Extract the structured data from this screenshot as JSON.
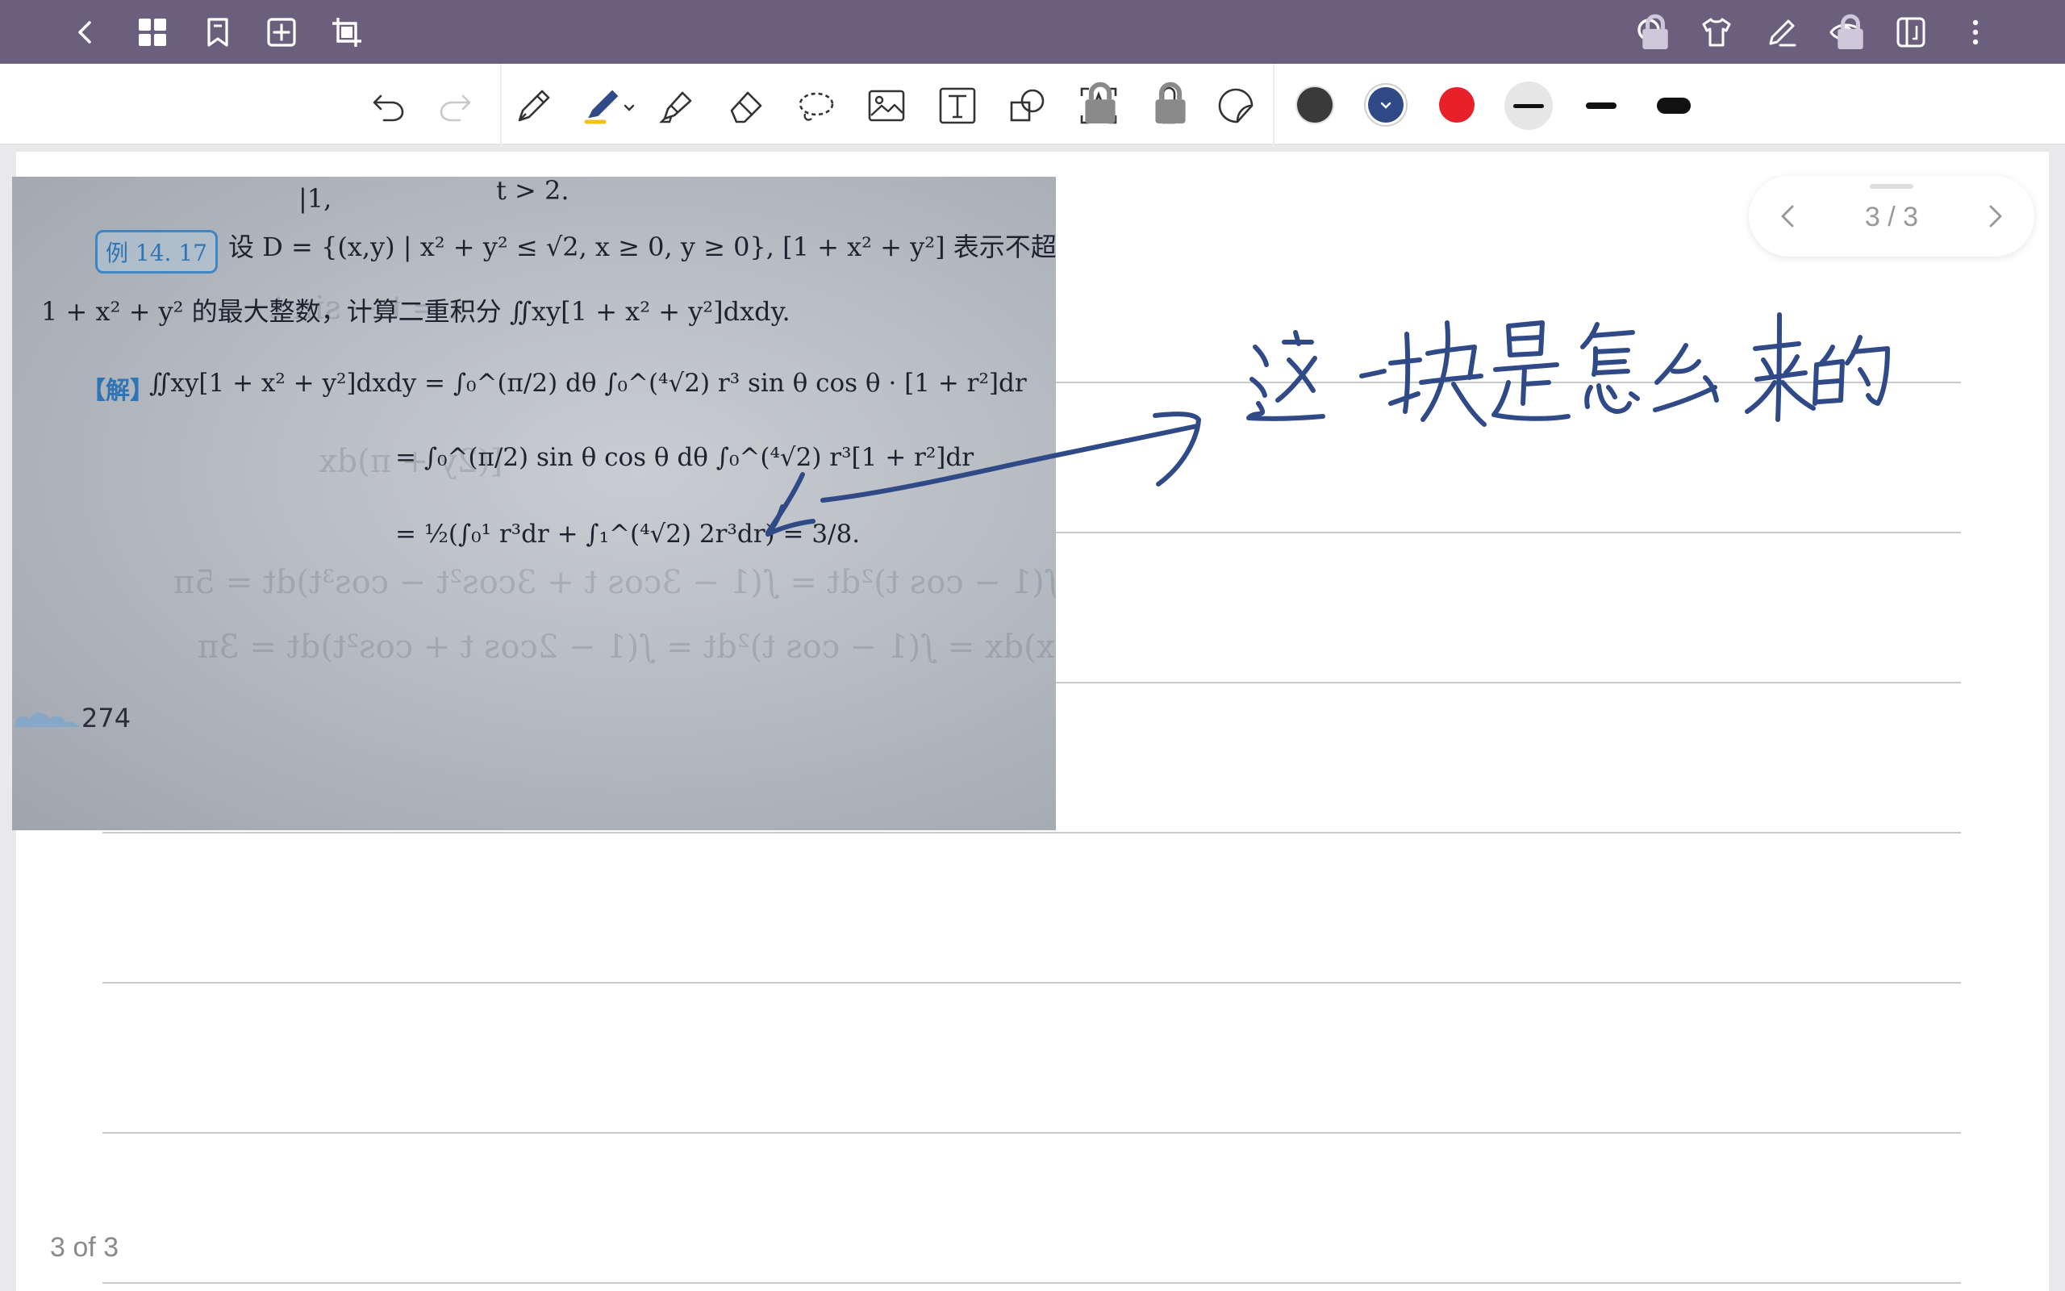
{
  "topbar": {
    "left_icons": [
      "back-chevron-icon",
      "grid-icon",
      "bookmark-icon",
      "add-page-icon",
      "crop-icon"
    ],
    "right_icons": [
      "search-icon",
      "theme-shirt-icon",
      "pen-edit-icon",
      "eye-icon",
      "layout-icon",
      "more-vertical-icon"
    ]
  },
  "toolbar": {
    "tools": [
      "undo-icon",
      "redo-icon",
      "fountain-pen-icon",
      "ballpoint-pen-icon",
      "highlighter-icon",
      "eraser-icon",
      "lasso-icon",
      "image-icon",
      "text-box-icon",
      "shapes-icon",
      "text-recognition-icon",
      "microphone-icon",
      "sticker-icon"
    ],
    "colors": [
      "#3a3a3a",
      "#2f4a86",
      "#e8202a"
    ],
    "selected_color": "#2f4a86",
    "stroke_widths": [
      "thin",
      "medium",
      "thick"
    ],
    "selected_stroke": "thin"
  },
  "pager": {
    "label": "3 / 3"
  },
  "page_footer": "3 of 3",
  "photo": {
    "top_fragment": "|1,",
    "top_fragment_right": "t > 2.",
    "example_badge": "例 14. 17",
    "problem_line1": "设 D = {(x,y) | x² + y² ≤ √2, x ≥ 0, y ≥ 0}, [1 + x² + y²] 表示不超过",
    "problem_line2": "1 + x² + y² 的最大整数，计算二重积分 ∬xy[1 + x² + y²]dxdy.",
    "solution_label": "【解】",
    "solution_line1": "∬xy[1 + x² + y²]dxdy = ∫₀^(π/2) dθ ∫₀^(⁴√2) r³ sin θ cos θ · [1 + r²]dr",
    "solution_line2": "= ∫₀^(π/2) sin θ cos θ dθ ∫₀^(⁴√2) r³[1 + r²]dr",
    "solution_line3": "= ½(∫₀¹ r³dr + ∫₁^(⁴√2) 2r³dr) = 3/8.",
    "page_number": "274"
  },
  "ink": {
    "color": "#2f4a86"
  }
}
